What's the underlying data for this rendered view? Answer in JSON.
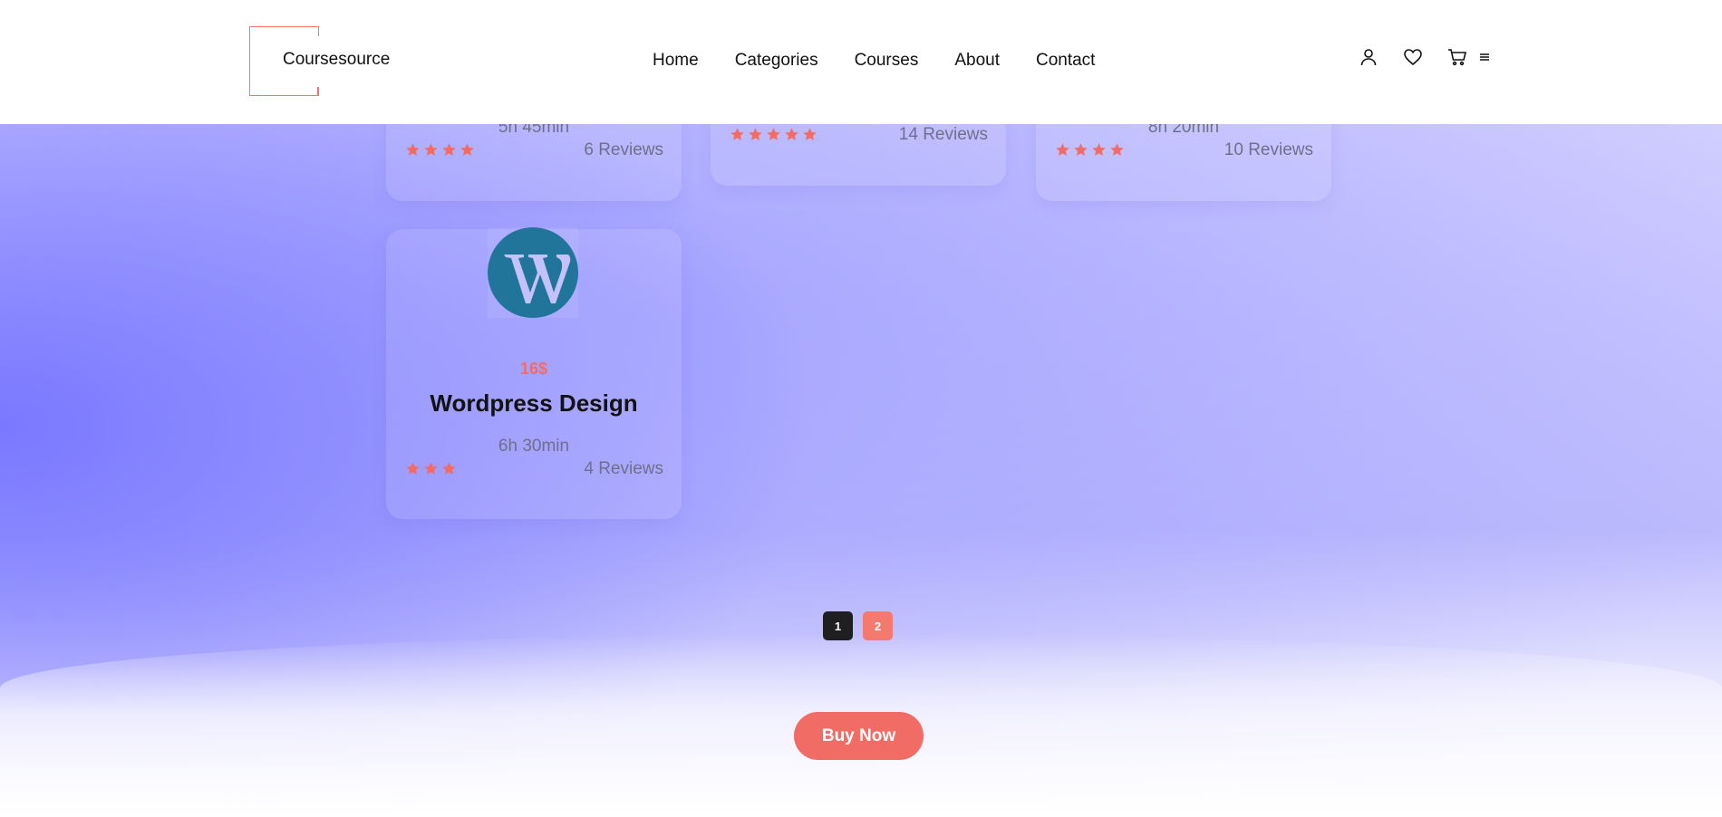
{
  "header": {
    "logo_text": "Coursesource",
    "nav": [
      "Home",
      "Categories",
      "Courses",
      "About",
      "Contact"
    ],
    "icons": [
      "user-icon",
      "heart-icon",
      "cart-icon",
      "menu-icon"
    ]
  },
  "courses": [
    {
      "duration": "5h 45min",
      "rating": 4,
      "reviews": "6 Reviews"
    },
    {
      "duration": "",
      "rating": 5,
      "reviews": "14 Reviews"
    },
    {
      "duration": "8h 20min",
      "rating": 4,
      "reviews": "10 Reviews"
    },
    {
      "price": "16$",
      "title": "Wordpress Design",
      "duration": "6h 30min",
      "rating": 3,
      "reviews": "4 Reviews",
      "icon": "wordpress-icon"
    }
  ],
  "pagination": {
    "pages": [
      "1",
      "2"
    ],
    "active": "1"
  },
  "buy_button": "Buy Now",
  "colors": {
    "accent": "#f26c66",
    "star": "#f26c66",
    "wordpress": "#21759b"
  }
}
